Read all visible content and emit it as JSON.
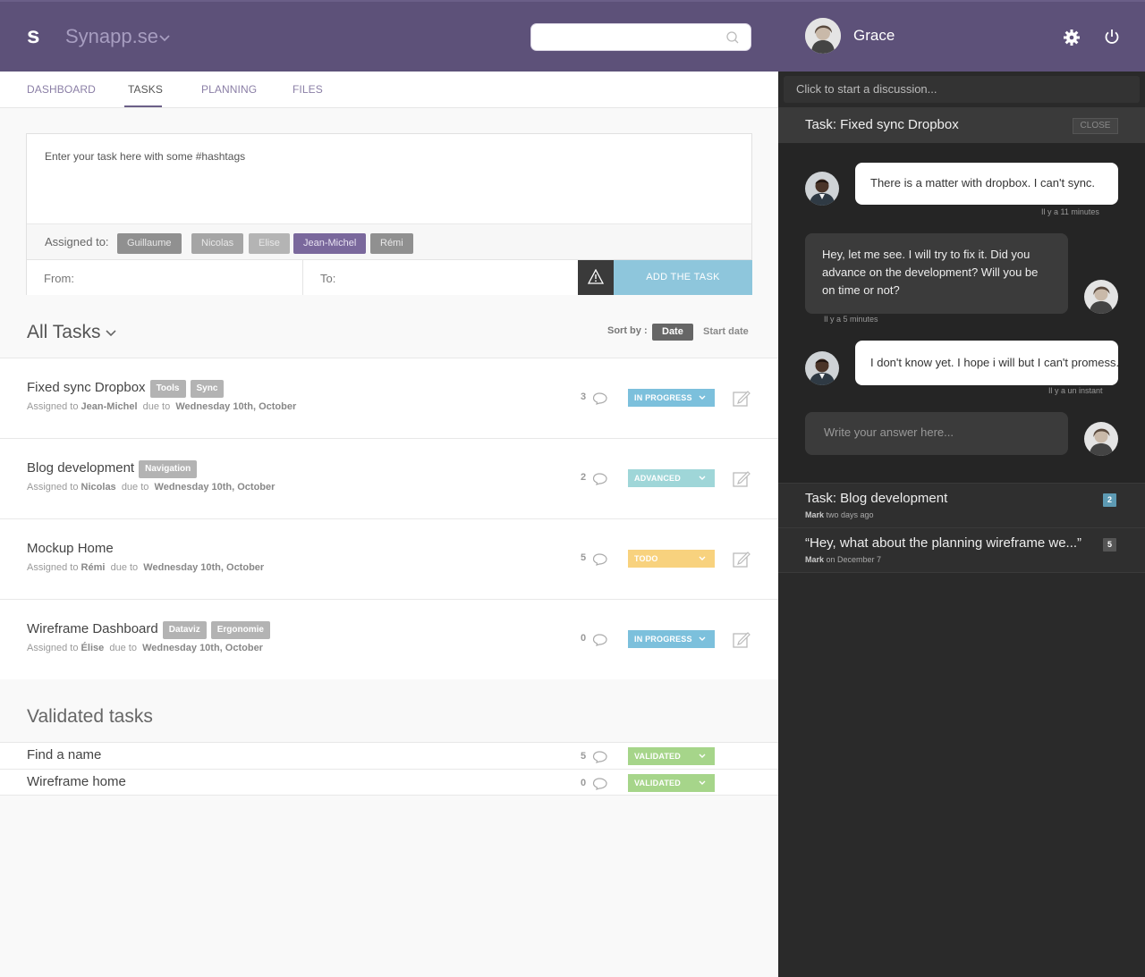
{
  "app": {
    "logo": "s",
    "name": "Synapp.se"
  },
  "tabs": [
    {
      "label": "DASHBOARD"
    },
    {
      "label": "TASKS"
    },
    {
      "label": "PLANNING"
    },
    {
      "label": "FILES"
    }
  ],
  "form": {
    "placeholder": "Enter your task here with some #hashtags",
    "assigned_label": "Assigned to:",
    "people": [
      "Guillaume",
      "Nicolas",
      "Elise",
      "Jean-Michel",
      "Rémi"
    ],
    "selected": "Jean-Michel",
    "from_label": "From:",
    "to_label": "To:",
    "add_label": "ADD THE TASK"
  },
  "list": {
    "title": "All Tasks",
    "sort_label": "Sort by :",
    "sort_options": [
      "Date",
      "Start date"
    ],
    "sort_selected": "Date"
  },
  "tasks": [
    {
      "title": "Fixed sync Dropbox",
      "tags": [
        "Tools",
        "Sync"
      ],
      "assigned_prefix": "Assigned to",
      "assignee": "Jean-Michel",
      "due_prefix": "due to",
      "due": "Wednesday 10th, October",
      "comments": "3",
      "status": "IN PROGRESS",
      "status_color": "#7cc0dc"
    },
    {
      "title": "Blog development",
      "tags": [
        "Navigation"
      ],
      "assigned_prefix": "Assigned to",
      "assignee": "Nicolas",
      "due_prefix": "due to",
      "due": "Wednesday 10th, October",
      "comments": "2",
      "status": "ADVANCED",
      "status_color": "#9fd6d8"
    },
    {
      "title": "Mockup Home",
      "tags": [],
      "assigned_prefix": "Assigned to",
      "assignee": "Rémi",
      "due_prefix": "due to",
      "due": "Wednesday 10th, October",
      "comments": "5",
      "status": "TODO",
      "status_color": "#f8d27e"
    },
    {
      "title": "Wireframe Dashboard",
      "tags": [
        "Dataviz",
        "Ergonomie"
      ],
      "assigned_prefix": "Assigned to",
      "assignee": "Élise",
      "due_prefix": "due to",
      "due": "Wednesday 10th, October",
      "comments": "0",
      "status": "IN PROGRESS",
      "status_color": "#7cc0dc"
    }
  ],
  "validated": {
    "title": "Validated tasks",
    "items": [
      {
        "title": "Find a name",
        "comments": "5",
        "status": "VALIDATED",
        "status_color": "#a6d58a"
      },
      {
        "title": "Wireframe home",
        "comments": "0",
        "status": "VALIDATED",
        "status_color": "#a6d58a"
      }
    ]
  },
  "user": {
    "name": "Grace"
  },
  "chat": {
    "start_placeholder": "Click to start a discussion...",
    "title": "Task: Fixed sync Dropbox",
    "close_label": "CLOSE",
    "messages": [
      {
        "text": "There is a matter with dropbox. I can't sync.",
        "time": "Il y a 11 minutes"
      },
      {
        "text": "Hey, let me see. I will try to fix it. Did you advance on the development? Will you be on time or not?",
        "time": "Il y a 5 minutes"
      },
      {
        "text": "I don't know yet. I hope i will but I can't promess.",
        "time": "Il y a un instant"
      }
    ],
    "answer_placeholder": "Write your answer here..."
  },
  "discussions": [
    {
      "title": "Task: Blog development",
      "author": "Mark",
      "when": "two days ago",
      "count": "2",
      "count_color": "#5d9ab3"
    },
    {
      "title": "“Hey, what about the planning wireframe we...”",
      "author": "Mark",
      "when": "on December 7",
      "count": "5",
      "count_color": "#555555"
    }
  ]
}
